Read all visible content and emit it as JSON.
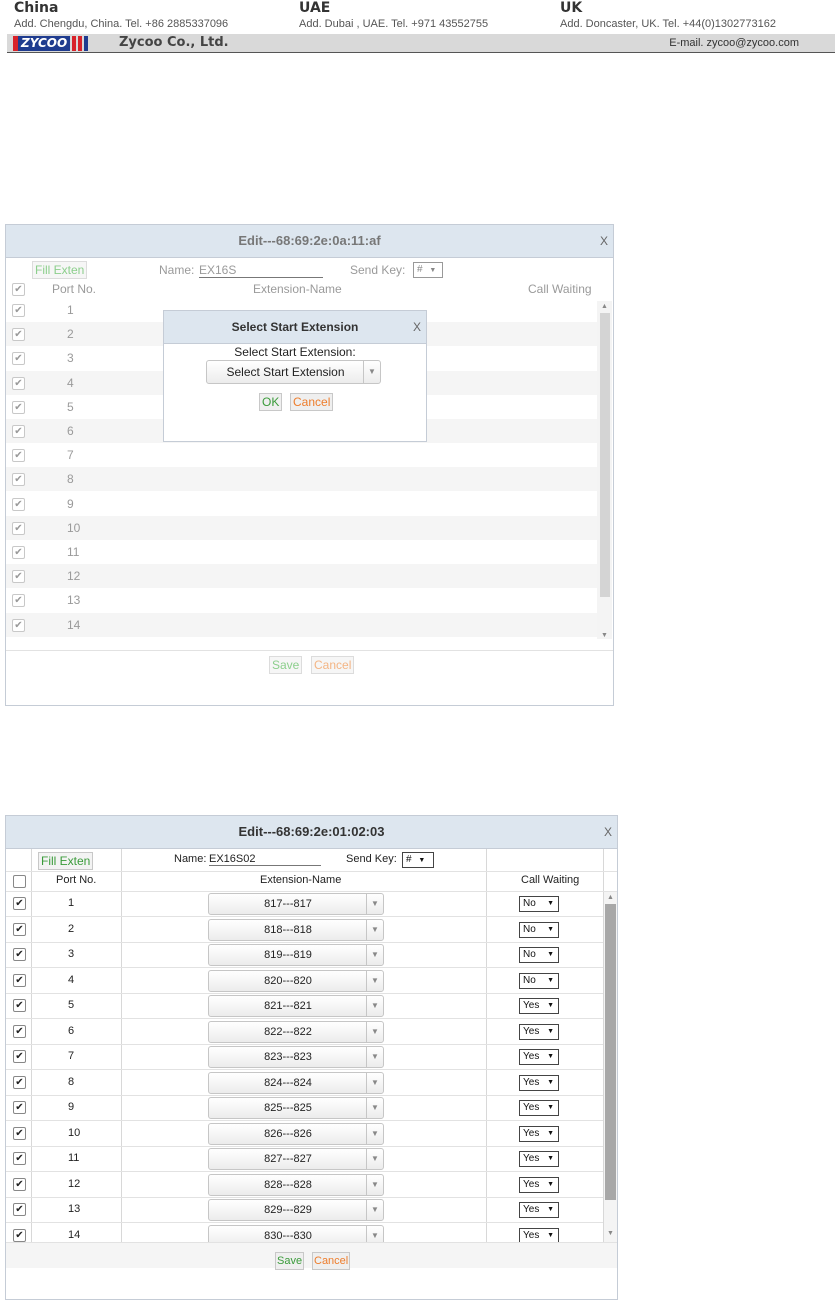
{
  "letterhead": {
    "offices": [
      {
        "country": "China",
        "address": "Add. Chengdu, China.   Tel. +86 2885337096"
      },
      {
        "country": "UAE",
        "address": "Add. Dubai , UAE.   Tel. +971 43552755"
      },
      {
        "country": "UK",
        "address": "Add. Doncaster, UK.   Tel. +44(0)1302773162"
      }
    ],
    "logo_text": "ZYCOO",
    "company": "Zycoo  Co., Ltd.",
    "email": "E-mail. zycoo@zycoo.com"
  },
  "dialog1": {
    "title": "Edit---68:69:2e:0a:11:af",
    "close": "X",
    "fill_exten": "Fill Exten",
    "name_label": "Name:",
    "name_value": "EX16S",
    "send_key_label": "Send Key:",
    "send_key_value": "#",
    "col_port": "Port No.",
    "col_ext": "Extension-Name",
    "col_cw": "Call Waiting",
    "ports": [
      "1",
      "2",
      "3",
      "4",
      "5",
      "6",
      "7",
      "8",
      "9",
      "10",
      "11",
      "12",
      "13",
      "14"
    ],
    "save": "Save",
    "cancel": "Cancel",
    "popup": {
      "title": "Select Start Extension",
      "close": "X",
      "label": "Select Start Extension:",
      "select_value": "Select Start Extension",
      "ok": "OK",
      "cancel": "Cancel"
    }
  },
  "dialog2": {
    "title": "Edit---68:69:2e:01:02:03",
    "close": "X",
    "fill_exten": "Fill Exten",
    "name_label": "Name:",
    "name_value": "EX16S02",
    "send_key_label": "Send Key:",
    "send_key_value": "#",
    "col_port": "Port No.",
    "col_ext": "Extension-Name",
    "col_cw": "Call Waiting",
    "rows": [
      {
        "port": "1",
        "ext": "817---817",
        "cw": "No"
      },
      {
        "port": "2",
        "ext": "818---818",
        "cw": "No"
      },
      {
        "port": "3",
        "ext": "819---819",
        "cw": "No"
      },
      {
        "port": "4",
        "ext": "820---820",
        "cw": "No"
      },
      {
        "port": "5",
        "ext": "821---821",
        "cw": "Yes"
      },
      {
        "port": "6",
        "ext": "822---822",
        "cw": "Yes"
      },
      {
        "port": "7",
        "ext": "823---823",
        "cw": "Yes"
      },
      {
        "port": "8",
        "ext": "824---824",
        "cw": "Yes"
      },
      {
        "port": "9",
        "ext": "825---825",
        "cw": "Yes"
      },
      {
        "port": "10",
        "ext": "826---826",
        "cw": "Yes"
      },
      {
        "port": "11",
        "ext": "827---827",
        "cw": "Yes"
      },
      {
        "port": "12",
        "ext": "828---828",
        "cw": "Yes"
      },
      {
        "port": "13",
        "ext": "829---829",
        "cw": "Yes"
      },
      {
        "port": "14",
        "ext": "830---830",
        "cw": "Yes"
      }
    ],
    "save": "Save",
    "cancel": "Cancel"
  },
  "icons": {
    "checkbox_checked": "✔",
    "dropdown_caret": "▼",
    "scroll_up": "▲",
    "scroll_down": "▼"
  },
  "colors": {
    "title_bar": "#dde6ef",
    "save_green": "#3a9b3a",
    "cancel_orange": "#ee7d2c",
    "logo_blue": "#1f3c8f",
    "logo_red": "#d8232a"
  }
}
